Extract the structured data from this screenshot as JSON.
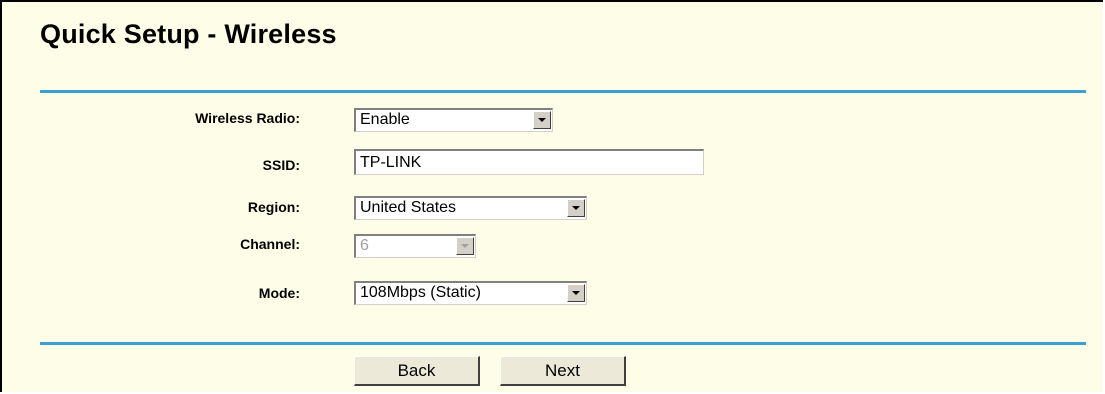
{
  "page": {
    "title": "Quick Setup - Wireless"
  },
  "form": {
    "wireless_radio": {
      "label": "Wireless Radio:",
      "value": "Enable"
    },
    "ssid": {
      "label": "SSID:",
      "value": "TP-LINK"
    },
    "region": {
      "label": "Region:",
      "value": "United States"
    },
    "channel": {
      "label": "Channel:",
      "value": "6",
      "disabled": true
    },
    "mode": {
      "label": "Mode:",
      "value": "108Mbps (Static)"
    }
  },
  "buttons": {
    "back": "Back",
    "next": "Next"
  },
  "colors": {
    "background": "#fefee8",
    "divider": "#3aa0d2"
  },
  "icons": {
    "dropdown": "chevron-down-icon"
  }
}
